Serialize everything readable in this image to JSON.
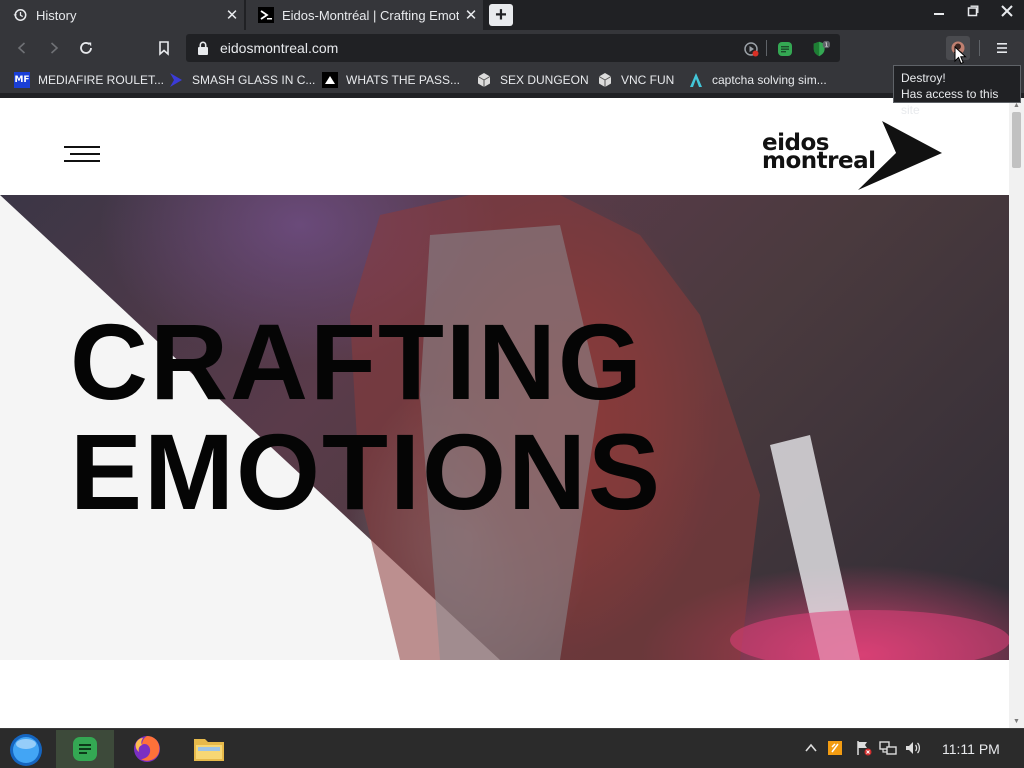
{
  "tabs": [
    {
      "title": "History",
      "icon": "history-icon"
    },
    {
      "title": "Eidos-Montréal | Crafting Emotion",
      "icon": "terminal-icon"
    }
  ],
  "toolbar": {
    "url": "eidosmontreal.com"
  },
  "bookmarks": [
    {
      "label": "MEDIAFIRE ROULET...",
      "icon": "mediafire-icon",
      "icon_text": "MF"
    },
    {
      "label": "SMASH GLASS IN C...",
      "icon": "smash-icon"
    },
    {
      "label": "WHATS THE PASS...",
      "icon": "triangle-icon"
    },
    {
      "label": "SEX DUNGEON",
      "icon": "cube-icon"
    },
    {
      "label": "VNC FUN",
      "icon": "cube-icon"
    },
    {
      "label": "captcha solving sim...",
      "icon": "a-logo-icon"
    }
  ],
  "tooltip": {
    "line1": "Destroy!",
    "line2": "Has access to this site"
  },
  "page": {
    "logo_line1": "eidos",
    "logo_line2": "montreal",
    "hero_line1": "CRAFTING",
    "hero_line2": "EMOTIONS"
  },
  "taskbar": {
    "clock": "11:11 PM"
  },
  "colors": {
    "tab_bg": "#35363a",
    "frame_bg": "#202124",
    "text": "#e8eaed"
  }
}
